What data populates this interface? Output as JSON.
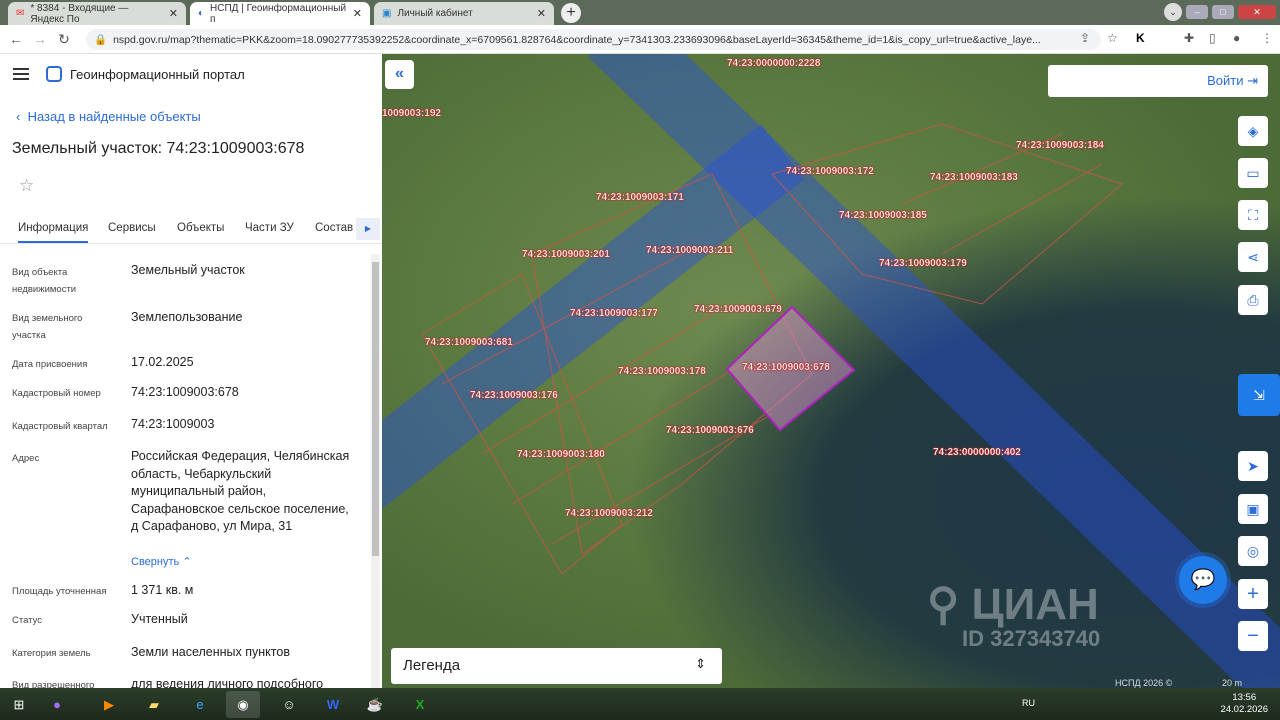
{
  "browser": {
    "tabs": [
      {
        "label": "* 8384 - Входящие — Яндекс По",
        "active": false
      },
      {
        "label": "НСПД | Геоинформационный п",
        "active": true
      },
      {
        "label": "Личный кабинет",
        "active": false
      }
    ],
    "url": "nspd.gov.ru/map?thematic=PKK&zoom=18.090277735392252&coordinate_x=6709561.828764&coordinate_y=7341303.233693096&baseLayerId=36345&theme_id=1&is_copy_url=true&active_laye..."
  },
  "sidebar": {
    "portal_title": "Геоинформационный портал",
    "back_label": "Назад в найденные объекты",
    "object_title": "Земельный участок: 74:23:1009003:678",
    "tabs": [
      "Информация",
      "Сервисы",
      "Объекты",
      "Части ЗУ",
      "Состав"
    ],
    "fields": [
      {
        "label": "Вид объекта недвижимости",
        "value": "Земельный участок"
      },
      {
        "label": "Вид земельного участка",
        "value": "Землепользование"
      },
      {
        "label": "Дата присвоения",
        "value": "17.02.2025"
      },
      {
        "label": "Кадастровый номер",
        "value": "74:23:1009003:678"
      },
      {
        "label": "Кадастровый квартал",
        "value": "74:23:1009003"
      },
      {
        "label": "Адрес",
        "value": "Российская Федерация, Челябинская область, Чебаркульский муниципальный район, Сарафановское сельское поселение, д Сарафаново, ул Мира, 31"
      },
      {
        "label": "Площадь уточненная",
        "value": "1 371 кв. м"
      },
      {
        "label": "Статус",
        "value": "Учтенный"
      },
      {
        "label": "Категория земель",
        "value": "Земли населенных пунктов"
      },
      {
        "label": "Вид разрешенного",
        "value": "для ведения личного подсобного"
      }
    ],
    "collapse_label": "Свернуть"
  },
  "map": {
    "login_label": "Войти",
    "legend_label": "Легенда",
    "copyright": "НСПД 2026 ©",
    "scale": "20 m",
    "watermark": "ЦИАН",
    "watermark_id": "ID 327343740",
    "parcels": [
      "74:23:0000000:2228",
      "1009003:192",
      "74:23:1009003:184",
      "74:23:1009003:172",
      "74:23:1009003:183",
      "74:23:1009003:171",
      "74:23:1009003:185",
      "74:23:1009003:201",
      "74:23:1009003:211",
      "74:23:1009003:179",
      "74:23:1009003:679",
      "74:23:1009003:177",
      "74:23:1009003:681",
      "74:23:1009003:678",
      "74:23:1009003:178",
      "74:23:1009003:176",
      "74:23:1009003:676",
      "74:23:0000000:402",
      "74:23:1009003:180",
      "74:23:1009003:212"
    ]
  },
  "taskbar": {
    "lang": "RU",
    "time": "13:56",
    "date": "24.02.2026"
  }
}
